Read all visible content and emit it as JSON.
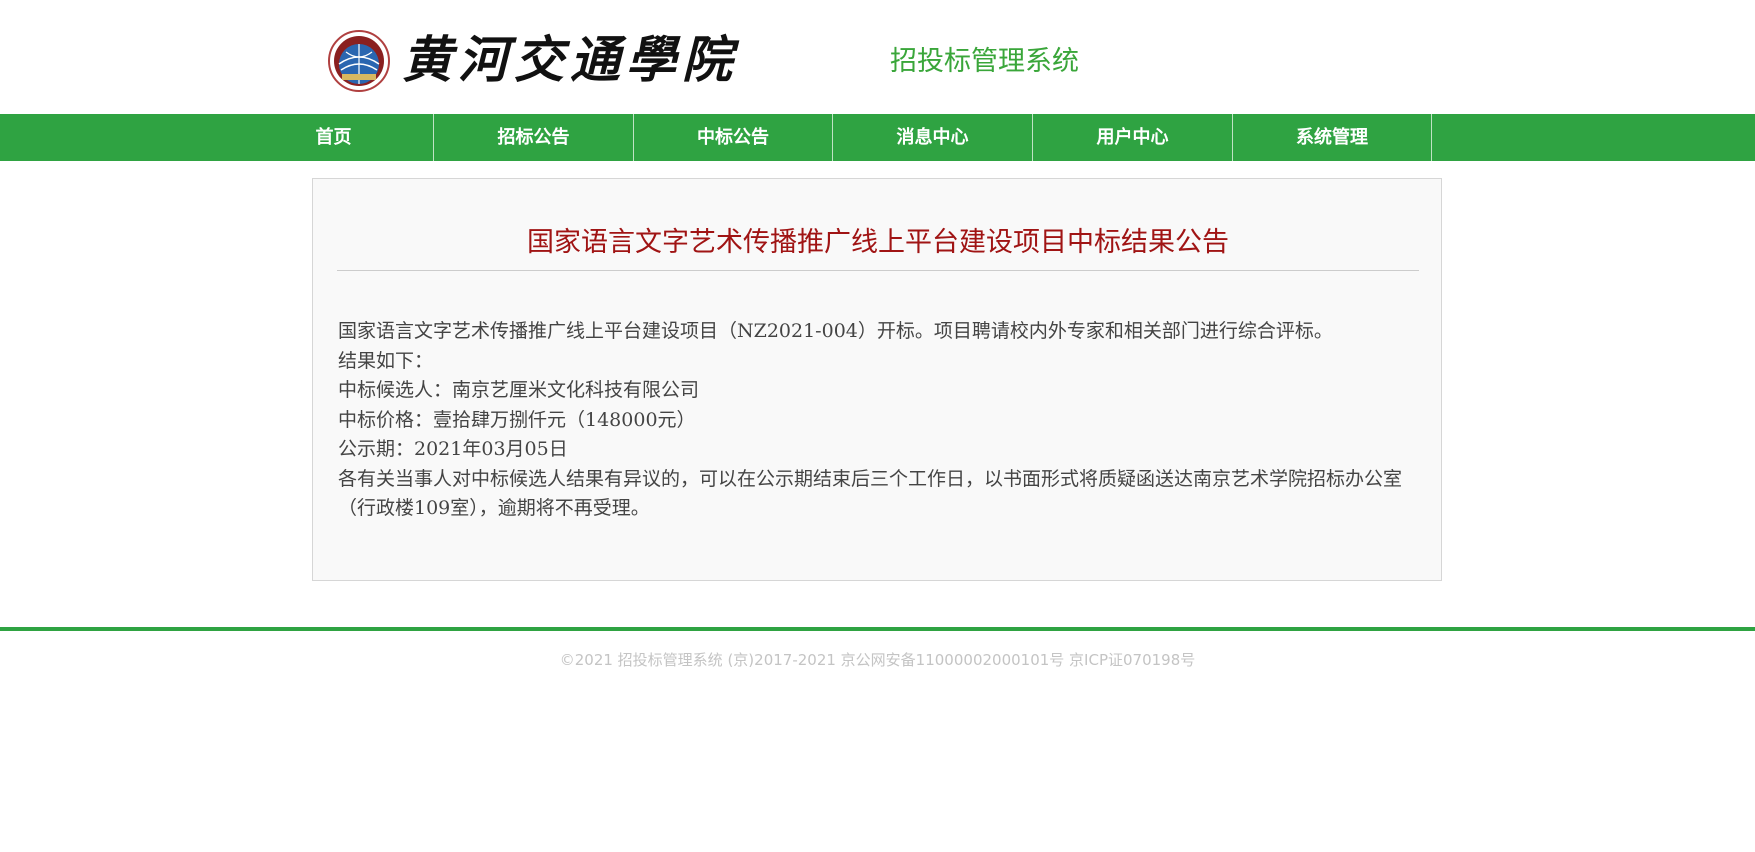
{
  "header": {
    "school_name": "黄河交通學院",
    "system_title": "招投标管理系统",
    "logo_icon": "school-emblem-icon"
  },
  "nav": {
    "items": [
      {
        "label": "首页"
      },
      {
        "label": "招标公告"
      },
      {
        "label": "中标公告"
      },
      {
        "label": "消息中心"
      },
      {
        "label": "用户中心"
      },
      {
        "label": "系统管理"
      }
    ]
  },
  "announcement": {
    "title": "国家语言文字艺术传播推广线上平台建设项目中标结果公告",
    "paragraphs": [
      "国家语言文字艺术传播推广线上平台建设项目（NZ2021-004）开标。项目聘请校内外专家和相关部门进行综合评标。",
      "结果如下：",
      "中标候选人：南京艺厘米文化科技有限公司",
      "中标价格：壹拾肆万捌仟元（148000元）",
      "公示期：2021年03月05日",
      "各有关当事人对中标候选人结果有异议的，可以在公示期结束后三个工作日，以书面形式将质疑函送达南京艺术学院招标办公室（行政楼109室），逾期将不再受理。"
    ]
  },
  "footer": {
    "text": "©2021 招投标管理系统 (京)2017-2021 京公网安备11000002000101号 京ICP证070198号"
  },
  "colors": {
    "brand_green": "#2fa342",
    "title_red": "#a01414"
  }
}
